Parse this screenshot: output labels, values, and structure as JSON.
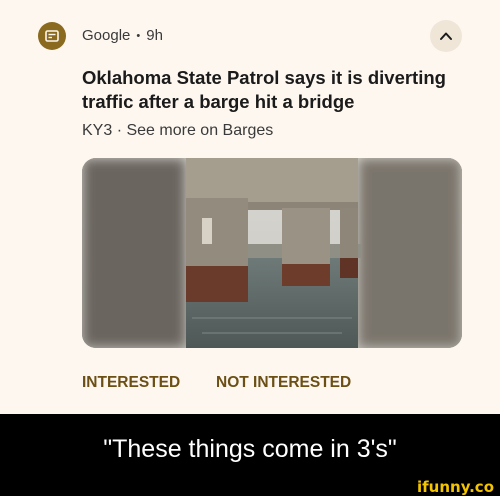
{
  "notification": {
    "app_name": "Google",
    "separator": "•",
    "time_ago": "9h",
    "headline": "Oklahoma State Patrol says it is diverting traffic after a barge hit a bridge",
    "source": "KY3",
    "sub_separator": "·",
    "see_more": "See more on Barges",
    "thumbnail_icon": "bridge-photo",
    "collapse_icon": "chevron-up-icon",
    "actions": {
      "interested": "INTERESTED",
      "not_interested": "NOT INTERESTED"
    }
  },
  "caption": "\"These things come in 3's\"",
  "watermark": "ifunny.co",
  "colors": {
    "card_bg": "#fdf7f0",
    "accent": "#6b4f15",
    "app_icon_bg": "#8a6a1e",
    "caption_bg": "#000000",
    "watermark": "#f4c400"
  }
}
